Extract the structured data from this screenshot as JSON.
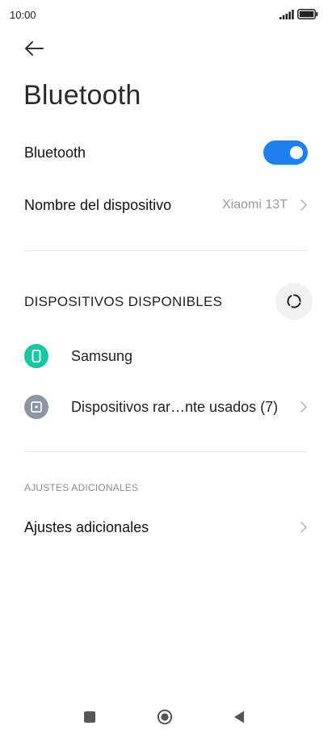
{
  "status_bar": {
    "time": "10:00"
  },
  "header": {
    "title": "Bluetooth"
  },
  "bluetooth_toggle": {
    "label": "Bluetooth",
    "state": "on"
  },
  "device_name": {
    "label": "Nombre del dispositivo",
    "value": "Xiaomi 13T"
  },
  "available_devices": {
    "heading": "DISPOSITIVOS DISPONIBLES",
    "items": [
      {
        "label": "Samsung",
        "icon": "phone-icon",
        "icon_color": "#19c7a3"
      },
      {
        "label": "Dispositivos rar…nte usados (7)",
        "icon": "device-icon",
        "icon_color": "#8e95a6"
      }
    ]
  },
  "additional": {
    "heading": "AJUSTES ADICIONALES",
    "item_label": "Ajustes adicionales"
  },
  "colors": {
    "accent": "#1e80f0"
  }
}
